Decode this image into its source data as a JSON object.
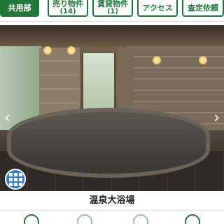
{
  "tabs": [
    {
      "label": "共用部",
      "sub": "",
      "active": true
    },
    {
      "label": "売り物件",
      "sub": "(14)",
      "active": false
    },
    {
      "label": "賃貸物件",
      "sub": "(1)",
      "active": false
    },
    {
      "label": "アクセス",
      "sub": "",
      "active": false
    },
    {
      "label": "査定依頼",
      "sub": "",
      "active": false
    }
  ],
  "colors": {
    "brand": "#1f7a3a",
    "accent": "#2f7fd6"
  },
  "photo": {
    "prev_icon": "chevron-left-icon",
    "next_icon": "chevron-right-icon",
    "grid_icon": "grid-icon"
  },
  "caption": "温泉大浴場",
  "bottom_icons": [
    "location-icon",
    "building-icon",
    "building-icon",
    "document-icon"
  ]
}
